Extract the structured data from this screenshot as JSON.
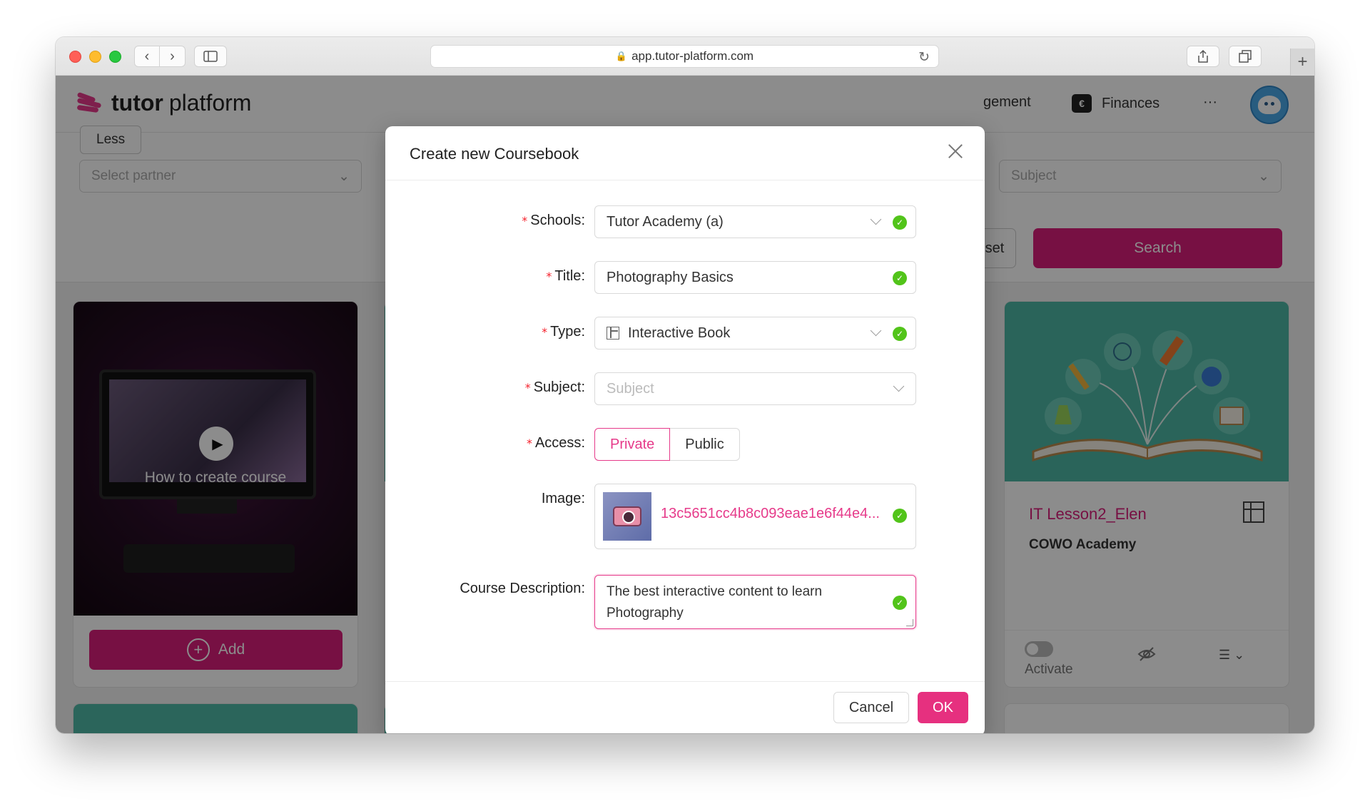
{
  "browser": {
    "url": "app.tutor-platform.com"
  },
  "app": {
    "logo_bold": "tutor",
    "logo_light": "platform",
    "header_partial_item": "gement",
    "finances_label": "Finances",
    "finances_icon": "finance-icon",
    "more_label": "···",
    "brand_color": "#e63a8a"
  },
  "filters": {
    "less_label": "Less",
    "partner_placeholder": "Select partner",
    "subject_placeholder": "Subject",
    "reset_partial": "set",
    "search_label": "Search"
  },
  "cards": {
    "video_caption": "How to create course",
    "add_label": "Add",
    "book_title": "IT Lesson2_Elen",
    "book_school": "COWO Academy",
    "activate_label": "Activate"
  },
  "modal": {
    "title": "Create new Coursebook",
    "fields": {
      "schools": {
        "label": "Schools",
        "value": "Tutor Academy (a)"
      },
      "title": {
        "label": "Title",
        "value": "Photography Basics"
      },
      "type": {
        "label": "Type",
        "value": "Interactive Book"
      },
      "subject": {
        "label": "Subject",
        "placeholder": "Subject"
      },
      "access": {
        "label": "Access",
        "options": [
          "Private",
          "Public"
        ],
        "selected": "Private"
      },
      "image": {
        "label": "Image",
        "file_name": "13c5651cc4b8c093eae1e6f44e4..."
      },
      "description": {
        "label": "Course Description",
        "value": "The best interactive content to learn Photography"
      }
    },
    "colon": ":",
    "required_mark": "*",
    "cancel_label": "Cancel",
    "ok_label": "OK"
  }
}
